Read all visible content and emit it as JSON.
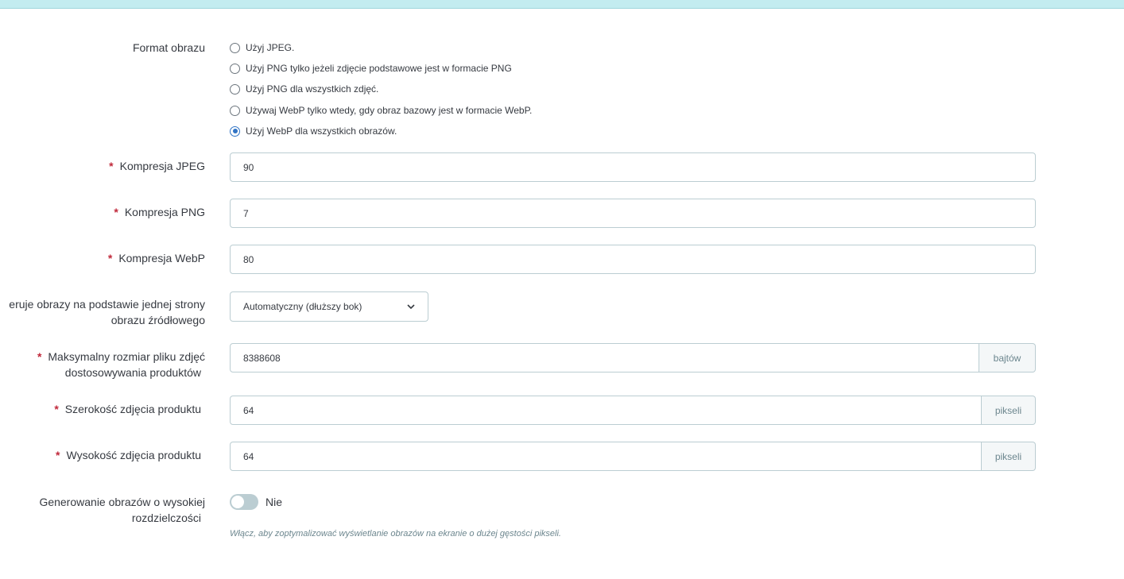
{
  "form": {
    "image_format": {
      "label": "Format obrazu",
      "options": [
        {
          "label": "Użyj JPEG.",
          "checked": false
        },
        {
          "label": "Użyj PNG tylko jeżeli zdjęcie podstawowe jest w formacie PNG",
          "checked": false
        },
        {
          "label": "Użyj PNG dla wszystkich zdjęć.",
          "checked": false
        },
        {
          "label": "Używaj WebP tylko wtedy, gdy obraz bazowy jest w formacie WebP.",
          "checked": false
        },
        {
          "label": "Użyj WebP dla wszystkich obrazów.",
          "checked": true
        }
      ]
    },
    "jpeg_compression": {
      "label": "Kompresja JPEG",
      "value": "90",
      "required": true
    },
    "png_compression": {
      "label": "Kompresja PNG",
      "value": "7",
      "required": true
    },
    "webp_compression": {
      "label": "Kompresja WebP",
      "value": "80",
      "required": true
    },
    "resize_mode": {
      "label_line1": "eruje obrazy na podstawie jednej strony",
      "label_line2": "obrazu źródłowego",
      "selected": "Automatyczny (dłuższy bok)"
    },
    "max_file_size": {
      "label_line1": "Maksymalny rozmiar pliku zdjęć",
      "label_line2": "dostosowywania produktów",
      "value": "8388608",
      "unit": "bajtów",
      "required": true
    },
    "product_image_width": {
      "label": "Szerokość zdjęcia produktu",
      "value": "64",
      "unit": "pikseli",
      "required": true
    },
    "product_image_height": {
      "label": "Wysokość zdjęcia produktu",
      "value": "64",
      "unit": "pikseli",
      "required": true
    },
    "high_dpi": {
      "label_line1": "Generowanie obrazów o wysokiej",
      "label_line2": "rozdzielczości",
      "state_label": "Nie",
      "enabled": false,
      "help": "Włącz, aby zoptymalizować wyświetlanie obrazów na ekranie o dużej gęstości pikseli."
    },
    "required_mark": "*"
  },
  "colors": {
    "accent": "#3074c5",
    "required": "#c0283a",
    "border": "#bbcdd2",
    "topbar": "#c3ecf0"
  }
}
